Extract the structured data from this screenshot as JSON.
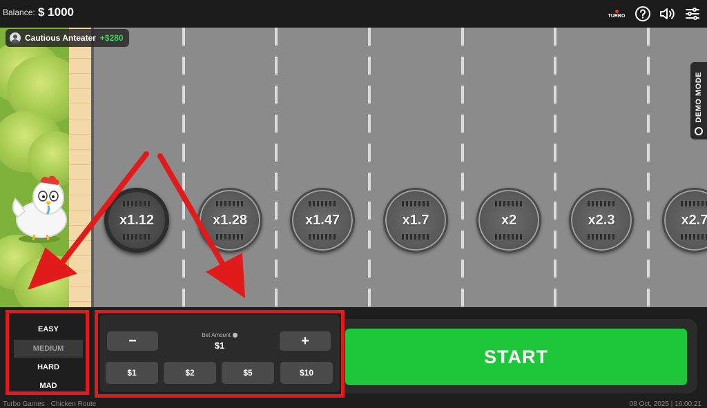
{
  "header": {
    "balance_label": "Balance:",
    "balance_value": "$ 1000",
    "icons": [
      "turbo-universe-logo",
      "help-icon",
      "volume-icon",
      "settings-sliders-icon"
    ],
    "logo_text": "TURBO UNIVERSE"
  },
  "player": {
    "name": "Cautious Anteater",
    "win": "+$280"
  },
  "demo_mode": "DEMO MODE",
  "multipliers": [
    "x1.12",
    "x1.28",
    "x1.47",
    "x1.7",
    "x2",
    "x2.3",
    "x2.7"
  ],
  "difficulty": {
    "options": [
      "EASY",
      "MEDIUM",
      "HARD",
      "MAD"
    ],
    "selected": "MEDIUM"
  },
  "bet": {
    "minus": "−",
    "plus": "+",
    "label": "Bet Amount",
    "value": "$1",
    "quick": [
      "$1",
      "$2",
      "$5",
      "$10"
    ]
  },
  "start_label": "START",
  "footer": {
    "left": "Turbo Games · Chicken Route",
    "right": "08 Oct, 2025 | 16:00:21"
  },
  "colors": {
    "start": "#1ec73a",
    "annotation": "#e11b1b",
    "win": "#39d353"
  }
}
